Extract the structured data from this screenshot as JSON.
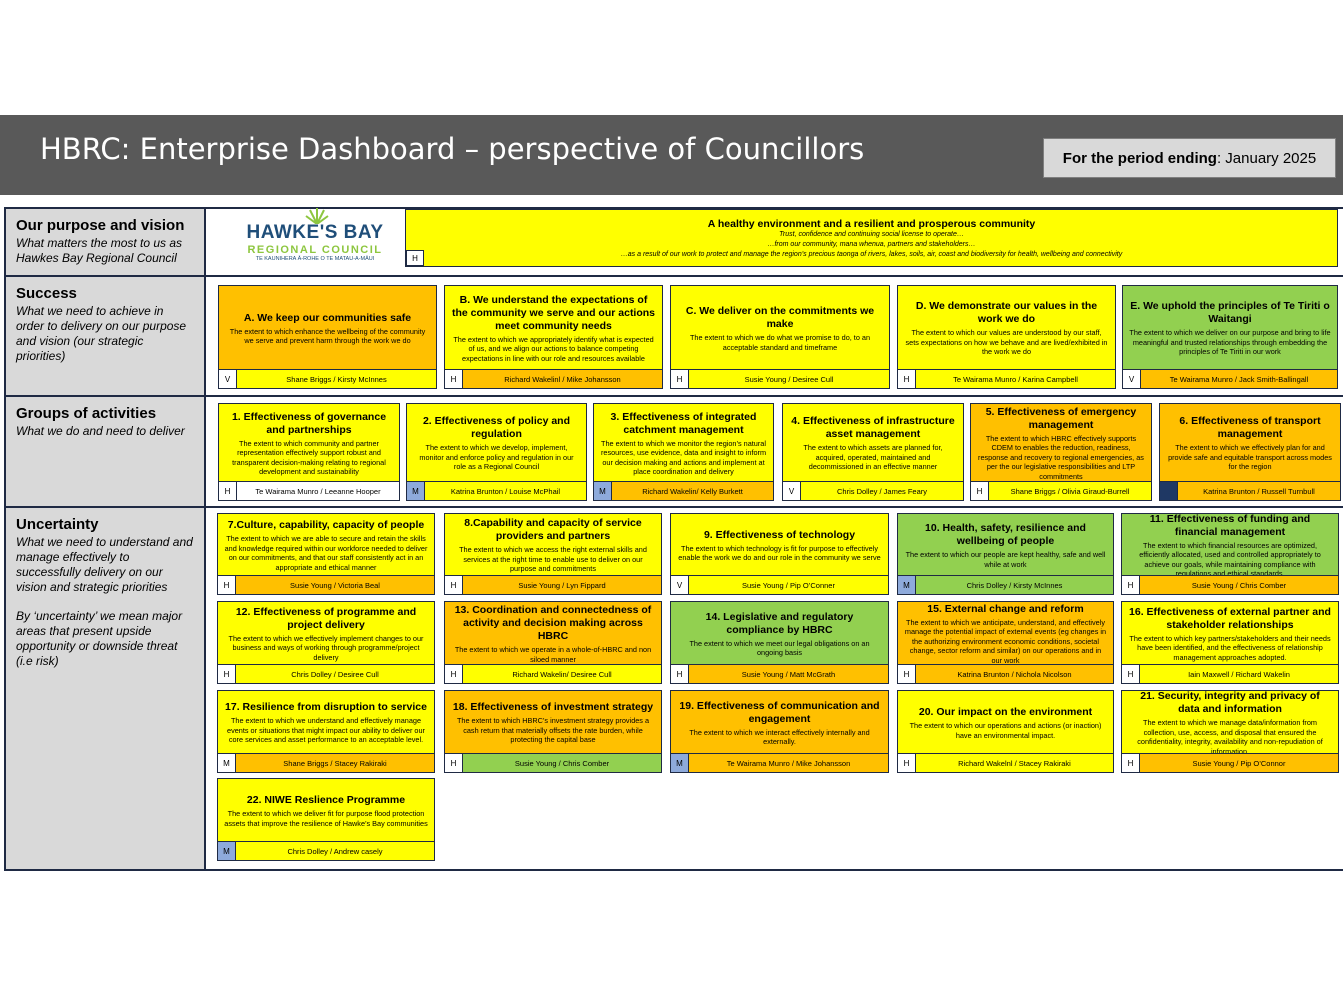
{
  "header": {
    "title": "HBRC: Enterprise Dashboard – perspective of Councillors",
    "period_label": "For the period ending",
    "period_value": ": January 2025"
  },
  "colors": {
    "header_bg": "#595959",
    "yellow": "#ffff00",
    "orange": "#ffc000",
    "green": "#92d050",
    "label_bg": "#d9d9d9",
    "badge_blue": "#8eaadb",
    "badge_dark": "#1f3864",
    "border": "#1f2a44"
  },
  "logo": {
    "name": "HAWKE'S BAY",
    "line2": "REGIONAL COUNCIL",
    "tagline": "TE KAUNIHERA Ā-ROHE O TE MATAU-A-MĀUI"
  },
  "rows": {
    "purpose": {
      "title": "Our purpose and vision",
      "subtitle": "What matters the most to us as Hawkes Bay Regional Council"
    },
    "success": {
      "title": "Success",
      "subtitle": "What we need to achieve in order to delivery on our purpose and vision (our strategic priorities)"
    },
    "groups": {
      "title": "Groups of activities",
      "subtitle": "What we do and need to deliver"
    },
    "uncertainty": {
      "title": "Uncertainty",
      "subtitle": "What we need to understand and manage effectively to successfully delivery on our vision and strategic priorities",
      "subtitle2": "By ‘uncertainty’ we mean major areas that present upside opportunity or downside threat (i.e risk)"
    }
  },
  "vision": {
    "title": "A healthy environment and a resilient and prosperous community",
    "line1": "Trust, confidence and continuing social license to operate…",
    "line2": "…from our community, mana whenua, partners and stakeholders…",
    "line3": "…as a result of our work to protect and manage the region’s precious taonga of rivers, lakes, soils, air, coast and biodiversity for health, wellbeing and connectivity",
    "badge": "H"
  },
  "success_cards": [
    {
      "title": "A. We keep our communities safe",
      "desc": "The extent to which enhance the wellbeing of the community we serve and prevent harm through the work we do",
      "badge": "V",
      "owners": "Shane Briggs / Kirsty McInnes",
      "color": "#ffc000",
      "foot_color": "#ffff00",
      "badge_color": "#ffffff"
    },
    {
      "title": "B. We understand the expectations of the community we serve and our actions meet community needs",
      "desc": "The extent to which we appropriately identify what is expected of us, and we align our actions to balance competing expectations in line with our role and resources available",
      "badge": "H",
      "owners": "Richard Wakelinl / Mike Johansson",
      "color": "#ffff00",
      "foot_color": "#ffc000",
      "badge_color": "#ffffff"
    },
    {
      "title": "C. We deliver on the commitments we make",
      "desc": "The extent to which we do what we promise to do, to an acceptable standard and timeframe",
      "badge": "H",
      "owners": "Susie Young / Desiree Cull",
      "color": "#ffff00",
      "foot_color": "#ffff00",
      "badge_color": "#ffffff"
    },
    {
      "title": "D. We demonstrate our values in the work we do",
      "desc": "The extent to which our values are understood by our staff, sets expectations on how we behave and are lived/exhibited in the work we do",
      "badge": "H",
      "owners": "Te Wairama Munro / Karina Campbell",
      "color": "#ffff00",
      "foot_color": "#ffff00",
      "badge_color": "#ffffff"
    },
    {
      "title": "E. We uphold the principles of Te Tiriti o Waitangi",
      "desc": "The extent to which we deliver on our purpose and bring to life meaningful and trusted relationships through embedding the principles of Te Tiriti in our work",
      "badge": "V",
      "owners": "Te Wairama Munro / Jack Smith-Ballingall",
      "color": "#92d050",
      "foot_color": "#ffc000",
      "badge_color": "#ffffff"
    }
  ],
  "group_cards": [
    {
      "title": "1. Effectiveness of governance and partnerships",
      "desc": "The extent to which community and partner representation effectively support robust and transparent decision-making relating to regional development and sustainability",
      "badge": "H",
      "owners": "Te Wairama Munro / Leeanne Hooper",
      "color": "#ffff00",
      "foot_color": "#ffffff",
      "badge_color": "#ffffff"
    },
    {
      "title": "2. Effectiveness of policy and regulation",
      "desc": "The extent to which we develop, implement, monitor and enforce policy and regulation in our role as a Regional Council",
      "badge": "M",
      "owners": "Katrina Brunton / Louise McPhail",
      "color": "#ffff00",
      "foot_color": "#ffff00",
      "badge_color": "#8eaadb"
    },
    {
      "title": "3. Effectiveness of integrated catchment management",
      "desc": "The extent to which we monitor the region’s natural resources, use evidence, data and insight to inform our decision making and actions and implement at place coordination and delivery",
      "badge": "M",
      "owners": "Richard Wakelin/ Kelly Burkett",
      "color": "#ffff00",
      "foot_color": "#ffc000",
      "badge_color": "#8eaadb"
    },
    {
      "title": "4. Effectiveness of infrastructure asset management",
      "desc": "The extent to which assets are planned for, acquired, operated, maintained and decommissioned in an effective manner",
      "badge": "V",
      "owners": "Chris Dolley / James Feary",
      "color": "#ffff00",
      "foot_color": "#ffff00",
      "badge_color": "#ffffff"
    },
    {
      "title": "5. Effectiveness of emergency management",
      "desc": "The extent to which HBRC effectively supports CDEM to enables the reduction, readiness, response and recovery to regional emergencies, as per the our legislative responsibilities and LTP commitments",
      "badge": "H",
      "owners": "Shane Briggs / Olivia Giraud-Burrell",
      "color": "#ffc000",
      "foot_color": "#ffff00",
      "badge_color": "#ffffff"
    },
    {
      "title": "6. Effectiveness of transport management",
      "desc": "The extent to which we effectively plan for and provide safe and equitable transport across modes for the region",
      "badge": "L",
      "owners": "Katrina Brunton / Russell Turnbull",
      "color": "#ffc000",
      "foot_color": "#ffc000",
      "badge_color": "#1f3864"
    }
  ],
  "uncertainty_cards": [
    {
      "title": "7.Culture, capability, capacity of people",
      "desc": "The extent to which we are able to secure and retain the skills and knowledge required within our workforce needed to deliver on our commitments, and that our staff consistently act in an appropriate and ethical manner",
      "badge": "H",
      "owners": "Susie Young / Victoria Beal",
      "color": "#ffff00",
      "foot_color": "#ffc000",
      "badge_color": "#ffffff"
    },
    {
      "title": "8.Capability and capacity of service providers and partners",
      "desc": "The extent to which we access the right external skills and services at the right time to enable use to deliver on our purpose and commitments",
      "badge": "H",
      "owners": "Susie Young / Lyn Fippard",
      "color": "#ffff00",
      "foot_color": "#ffc000",
      "badge_color": "#ffffff"
    },
    {
      "title": "9. Effectiveness of technology",
      "desc": "The extent to which technology is fit for purpose to effectively enable the work we do and our role in the community we serve",
      "badge": "V",
      "owners": "Susie Young / Pip O’Conner",
      "color": "#ffff00",
      "foot_color": "#ffff00",
      "badge_color": "#ffffff"
    },
    {
      "title": "10. Health, safety, resilience and wellbeing of people",
      "desc": "The extent to which our people are kept healthy, safe and well while at work",
      "badge": "M",
      "owners": "Chris Dolley / Kirsty McInnes",
      "color": "#92d050",
      "foot_color": "#92d050",
      "badge_color": "#8eaadb"
    },
    {
      "title": "11. Effectiveness of funding and financial management",
      "desc": "The extent to which financial resources are optimized, efficiently allocated, used and controlled appropriately to achieve our goals, while maintaining compliance with regulations and ethical standards.",
      "badge": "H",
      "owners": "Susie Young / Chris Comber",
      "color": "#92d050",
      "foot_color": "#ffc000",
      "badge_color": "#ffffff"
    },
    {
      "title": "12. Effectiveness of programme and project delivery",
      "desc": "The extent to which we effectively implement changes to our business and ways of working through programme/project delivery",
      "badge": "H",
      "owners": "Chris Dolley / Desiree Cull",
      "color": "#ffff00",
      "foot_color": "#ffff00",
      "badge_color": "#ffffff"
    },
    {
      "title": "13. Coordination and connectedness of activity and decision making across HBRC",
      "desc": "The extent to which we operate in a whole-of-HBRC and non siloed manner",
      "badge": "H",
      "owners": "Richard Wakelin/ Desiree Cull",
      "color": "#ffc000",
      "foot_color": "#ffff00",
      "badge_color": "#ffffff"
    },
    {
      "title": "14. Legislative and regulatory compliance by HBRC",
      "desc": "The extent to which we meet our legal obligations on an ongoing basis",
      "badge": "H",
      "owners": "Susie Young / Matt McGrath",
      "color": "#92d050",
      "foot_color": "#ffc000",
      "badge_color": "#ffffff"
    },
    {
      "title": "15. External change and reform",
      "desc": "The extent to which we anticipate, understand, and effectively manage the potential impact of external events (eg changes in the authorizing environment economic conditions, societal change, sector reform and similar) on our operations and in our work",
      "badge": "H",
      "owners": "Katrina Brunton / Nichola Nicolson",
      "color": "#ffc000",
      "foot_color": "#ffc000",
      "badge_color": "#ffffff"
    },
    {
      "title": "16. Effectiveness of external partner and stakeholder relationships",
      "desc": "The extent to which key partners/stakeholders and their needs have been identified, and the effectiveness of relationship management approaches adopted.",
      "badge": "H",
      "owners": "Iain Maxwell / Richard Wakelin",
      "color": "#ffff00",
      "foot_color": "#ffff00",
      "badge_color": "#ffffff"
    },
    {
      "title": "17. Resilience from disruption to service",
      "desc": "The extent to which we understand and effectively manage events or situations that might impact our ability to deliver our core services and asset performance to an acceptable level.",
      "badge": "M",
      "owners": "Shane Briggs / Stacey Rakiraki",
      "color": "#ffff00",
      "foot_color": "#ffc000",
      "badge_color": "#ffffff"
    },
    {
      "title": "18. Effectiveness of investment strategy",
      "desc": "The extent to which HBRC’s investment strategy provides a cash return that materially offsets the rate burden, while protecting the capital base",
      "badge": "H",
      "owners": "Susie Young / Chris Comber",
      "color": "#ffc000",
      "foot_color": "#92d050",
      "badge_color": "#ffffff"
    },
    {
      "title": "19. Effectiveness of communication and engagement",
      "desc": "The extent to which we interact effectively internally and externally.",
      "badge": "M",
      "owners": "Te Wairama Munro / Mike Johansson",
      "color": "#ffc000",
      "foot_color": "#ffc000",
      "badge_color": "#8eaadb"
    },
    {
      "title": "20. Our impact on the environment",
      "desc": "The extent to which our operations and actions (or inaction) have an environmental impact.",
      "badge": "H",
      "owners": "Richard Wakelnl / Stacey Rakiraki",
      "color": "#ffff00",
      "foot_color": "#ffff00",
      "badge_color": "#ffffff"
    },
    {
      "title": "21. Security, integrity and privacy of data and information",
      "desc": "The extent to which we manage data/information from collection, use, access, and disposal that ensured the confidentiality, integrity, availability and non-repudiation of information.",
      "badge": "H",
      "owners": "Susie Young / Pip O’Connor",
      "color": "#ffff00",
      "foot_color": "#ffc000",
      "badge_color": "#ffffff"
    },
    {
      "title": "22. NIWE Reslience Programme",
      "desc": "The extent to which we deliver fit for purpose flood protection assets that improve the resilience of Hawke’s Bay communities",
      "badge": "M",
      "owners": "Chris Dolley / Andrew casely",
      "color": "#ffff00",
      "foot_color": "#ffff00",
      "badge_color": "#8eaadb"
    }
  ]
}
